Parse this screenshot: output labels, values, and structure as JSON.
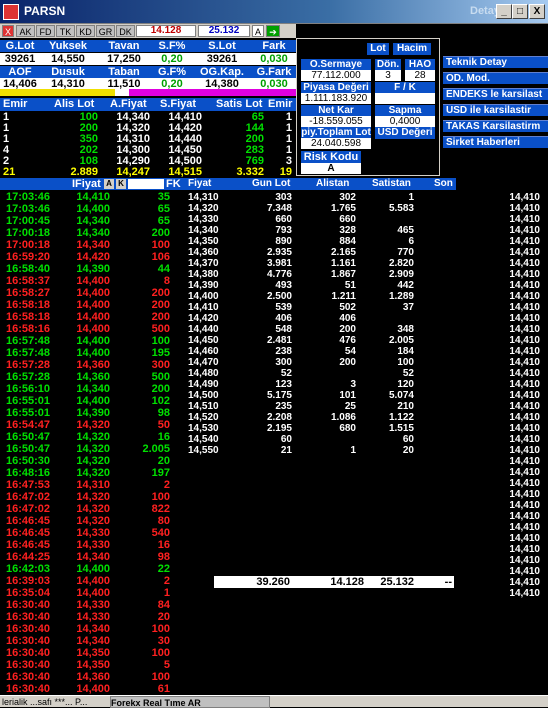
{
  "window": {
    "title": "PARSN",
    "right_title": "Detay",
    "min": "_",
    "max": "□",
    "close": "X"
  },
  "toolbar": {
    "close": "X",
    "tabs": [
      "AK",
      "FD",
      "TK",
      "KD",
      "GR",
      "DK"
    ],
    "price_left": "14.128",
    "price_right": "25.132",
    "a_label": "A"
  },
  "summary": {
    "headers1": [
      "G.Lot",
      "Yuksek",
      "Tavan",
      "S.F%",
      "S.Lot",
      "Fark"
    ],
    "values1": [
      "39261",
      "14,550",
      "17,250",
      "0,20",
      "39261",
      "0,030"
    ],
    "headers2": [
      "AOF",
      "Dusuk",
      "Taban",
      "G.F%",
      "OG.Kap.",
      "G.Fark"
    ],
    "values2": [
      "14,406",
      "14,310",
      "11,510",
      "0,20",
      "14,380",
      "0,030"
    ]
  },
  "market": {
    "headers": [
      "Emir",
      "Alis Lot",
      "A.Fiyat",
      "S.Fiyat",
      "Satis Lot",
      "Emir"
    ],
    "rows": [
      [
        "1",
        "100",
        "14,340",
        "14,410",
        "65",
        "1"
      ],
      [
        "1",
        "200",
        "14,320",
        "14,420",
        "144",
        "1"
      ],
      [
        "1",
        "350",
        "14,310",
        "14,440",
        "200",
        "1"
      ],
      [
        "4",
        "202",
        "14,300",
        "14,450",
        "283",
        "1"
      ],
      [
        "2",
        "108",
        "14,290",
        "14,500",
        "769",
        "3"
      ],
      [
        "21",
        "2.889",
        "14,247",
        "14,515",
        "3.332",
        "19"
      ]
    ]
  },
  "panel": {
    "lot": "Lot",
    "hacim": "Hacim",
    "osermaye_label": "O.Sermaye",
    "osermaye": "77.112.000",
    "don_label": "Dön.",
    "don": "3",
    "hao_label": "HAO",
    "hao": "28",
    "piyasa_label": "Piyasa Değeri",
    "piyasa": "1.111.183.920",
    "fk_label": "F / K",
    "fk": "",
    "netkar_label": "Net Kar",
    "netkar": "-18.559.055",
    "sapma_label": "Sapma",
    "sapma": "0,4000",
    "piytop_label": "piy.Toplam Lot",
    "piytop": "24.040.598",
    "usd_label": "USD Değeri",
    "risk_label": "Risk Kodu",
    "risk": "A"
  },
  "menu": [
    "Teknik Detay",
    "OD. Mod.",
    "ENDEKS le karsilast",
    "USD ile karsilastir",
    "TAKAS Karsilastirm",
    "Sirket Haberleri"
  ],
  "trades_header": {
    "price": "IFiyat",
    "a": "A",
    "k": "K",
    "fk": "FK"
  },
  "trades": [
    [
      "17:03:46",
      "14,410",
      "35",
      "g"
    ],
    [
      "17:03:46",
      "14,400",
      "65",
      "g"
    ],
    [
      "17:00:45",
      "14,340",
      "65",
      "g"
    ],
    [
      "17:00:18",
      "14,340",
      "200",
      "g"
    ],
    [
      "17:00:18",
      "14,340",
      "100",
      "r"
    ],
    [
      "16:59:20",
      "14,420",
      "106",
      "r"
    ],
    [
      "16:58:40",
      "14,390",
      "44",
      "g"
    ],
    [
      "16:58:37",
      "14,400",
      "8",
      "r"
    ],
    [
      "16:58:27",
      "14,400",
      "200",
      "r"
    ],
    [
      "16:58:18",
      "14,400",
      "200",
      "r"
    ],
    [
      "16:58:18",
      "14,400",
      "200",
      "r"
    ],
    [
      "16:58:16",
      "14,400",
      "500",
      "r"
    ],
    [
      "16:57:48",
      "14,400",
      "100",
      "g"
    ],
    [
      "16:57:48",
      "14,400",
      "195",
      "g"
    ],
    [
      "16:57:28",
      "14,360",
      "300",
      "r"
    ],
    [
      "16:57:28",
      "14,360",
      "500",
      "g"
    ],
    [
      "16:56:10",
      "14,340",
      "200",
      "g"
    ],
    [
      "16:55:01",
      "14,400",
      "102",
      "g"
    ],
    [
      "16:55:01",
      "14,390",
      "98",
      "g"
    ],
    [
      "16:54:47",
      "14,320",
      "50",
      "r"
    ],
    [
      "16:50:47",
      "14,320",
      "16",
      "g"
    ],
    [
      "16:50:47",
      "14,320",
      "2.005",
      "g"
    ],
    [
      "16:50:30",
      "14,320",
      "20",
      "g"
    ],
    [
      "16:48:16",
      "14,320",
      "197",
      "g"
    ],
    [
      "16:47:53",
      "14,310",
      "2",
      "r"
    ],
    [
      "16:47:02",
      "14,320",
      "100",
      "r"
    ],
    [
      "16:47:02",
      "14,320",
      "822",
      "r"
    ],
    [
      "16:46:45",
      "14,320",
      "80",
      "r"
    ],
    [
      "16:46:45",
      "14,330",
      "540",
      "r"
    ],
    [
      "16:46:45",
      "14,330",
      "16",
      "r"
    ],
    [
      "16:44:25",
      "14,340",
      "98",
      "r"
    ],
    [
      "16:42:03",
      "14,400",
      "22",
      "g"
    ],
    [
      "16:39:03",
      "14,400",
      "2",
      "r"
    ],
    [
      "16:35:04",
      "14,400",
      "1",
      "r"
    ],
    [
      "16:30:40",
      "14,330",
      "84",
      "r"
    ],
    [
      "16:30:40",
      "14,330",
      "20",
      "r"
    ],
    [
      "16:30:40",
      "14,340",
      "100",
      "r"
    ],
    [
      "16:30:40",
      "14,340",
      "30",
      "r"
    ],
    [
      "16:30:40",
      "14,350",
      "100",
      "r"
    ],
    [
      "16:30:40",
      "14,350",
      "5",
      "r"
    ],
    [
      "16:30:40",
      "14,360",
      "100",
      "r"
    ],
    [
      "16:30:40",
      "14,400",
      "61",
      "r"
    ]
  ],
  "depth_header": [
    "Fiyat",
    "Gun Lot",
    "Alistan",
    "Satistan",
    "Son"
  ],
  "depth": [
    [
      "14,310",
      "303",
      "302",
      "1"
    ],
    [
      "14,320",
      "7.348",
      "1.765",
      "5.583"
    ],
    [
      "14,330",
      "660",
      "660",
      ""
    ],
    [
      "14,340",
      "793",
      "328",
      "465"
    ],
    [
      "14,350",
      "890",
      "884",
      "6"
    ],
    [
      "14,360",
      "2.935",
      "2.165",
      "770"
    ],
    [
      "14,370",
      "3.981",
      "1.161",
      "2.820"
    ],
    [
      "14,380",
      "4.776",
      "1.867",
      "2.909"
    ],
    [
      "14,390",
      "493",
      "51",
      "442"
    ],
    [
      "14,400",
      "2.500",
      "1.211",
      "1.289"
    ],
    [
      "14,410",
      "539",
      "502",
      "37"
    ],
    [
      "14,420",
      "406",
      "406",
      ""
    ],
    [
      "14,440",
      "548",
      "200",
      "348"
    ],
    [
      "14,450",
      "2.481",
      "476",
      "2.005"
    ],
    [
      "14,460",
      "238",
      "54",
      "184"
    ],
    [
      "14,470",
      "300",
      "200",
      "100"
    ],
    [
      "14,480",
      "52",
      "",
      "52"
    ],
    [
      "14,490",
      "123",
      "3",
      "120"
    ],
    [
      "14,500",
      "5.175",
      "101",
      "5.074"
    ],
    [
      "14,510",
      "235",
      "25",
      "210"
    ],
    [
      "14,520",
      "2.208",
      "1.086",
      "1.122"
    ],
    [
      "14,530",
      "2.195",
      "680",
      "1.515"
    ],
    [
      "14,540",
      "60",
      "",
      "60"
    ],
    [
      "14,550",
      "21",
      "1",
      "20"
    ]
  ],
  "son_values": [
    "14,410",
    "14,410",
    "14,410",
    "14,410",
    "14,410",
    "14,410",
    "14,410",
    "14,410",
    "14,410",
    "14,410",
    "14,410",
    "14,410",
    "14,410",
    "14,410",
    "14,410",
    "14,410",
    "14,410",
    "14,410",
    "14,410",
    "14,410",
    "14,410",
    "14,410",
    "14,410",
    "14,410",
    "14,410",
    "14,410",
    "14,410",
    "14,410",
    "14,410",
    "14,410",
    "14,410",
    "14,410",
    "14,410",
    "14,410",
    "14,410",
    "14,410",
    "14,410"
  ],
  "totals": {
    "gun": "39.260",
    "alis": "14.128",
    "satis": "25.132",
    "dash": "--"
  },
  "taskbar": {
    "item1": "lerialik ...safı ***...  P...",
    "item2": "Forekx Real Tıme AR"
  },
  "colors": {
    "green": "#00e000",
    "red": "#ff2020",
    "blue": "#0a50c8"
  }
}
